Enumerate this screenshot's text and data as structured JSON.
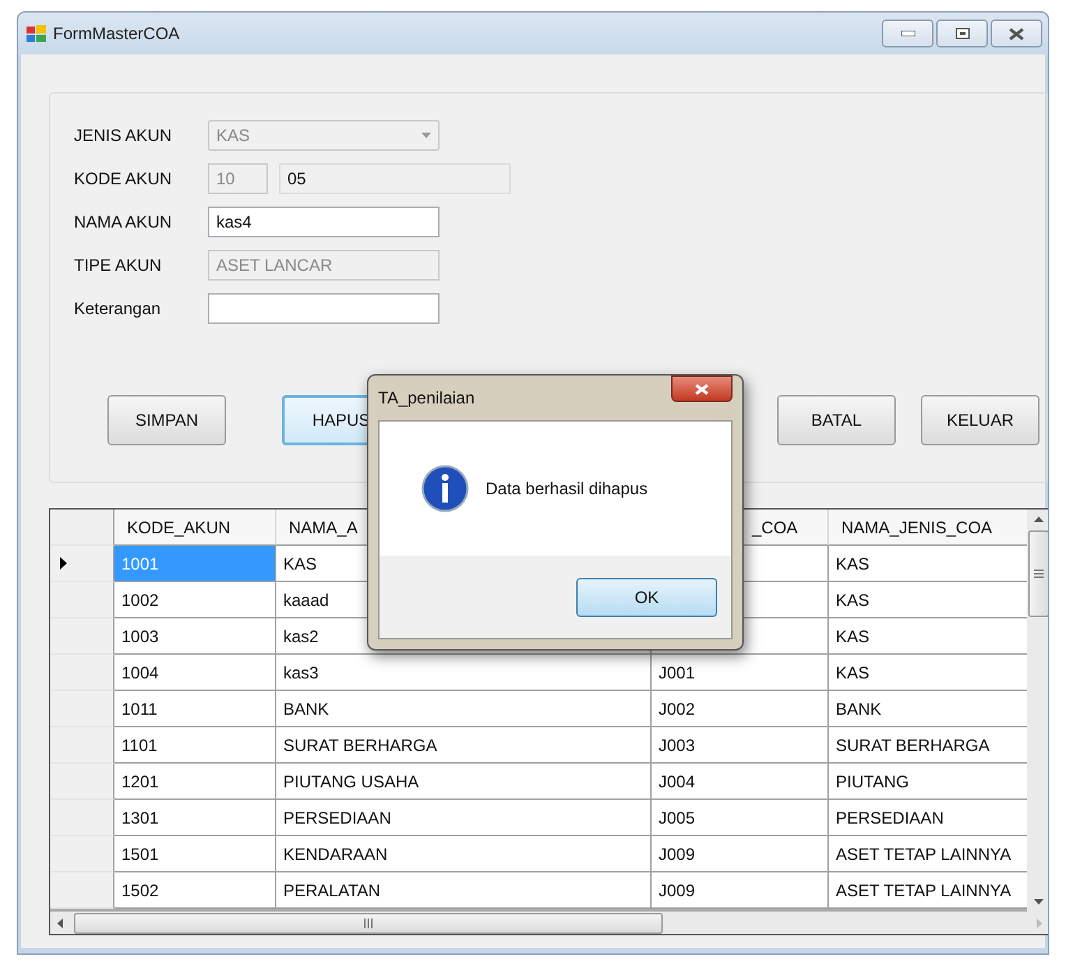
{
  "window": {
    "title": "FormMasterCOA"
  },
  "form": {
    "rows": [
      {
        "label": "JENIS AKUN",
        "fields": [
          {
            "kind": "combo",
            "value": "KAS",
            "disabled": true,
            "readonly": false
          }
        ]
      },
      {
        "label": "KODE AKUN",
        "fields": [
          {
            "kind": "short",
            "value": "10",
            "disabled": true,
            "readonly": false
          },
          {
            "kind": "text",
            "value": "05",
            "disabled": false,
            "readonly": true
          }
        ]
      },
      {
        "label": "NAMA AKUN",
        "fields": [
          {
            "kind": "text",
            "value": "kas4",
            "disabled": false,
            "readonly": false
          }
        ]
      },
      {
        "label": "TIPE AKUN",
        "fields": [
          {
            "kind": "text",
            "value": "ASET LANCAR",
            "disabled": true,
            "readonly": false
          }
        ]
      },
      {
        "label": "Keterangan",
        "fields": [
          {
            "kind": "text",
            "disabled": false,
            "readonly": false
          }
        ]
      }
    ]
  },
  "buttons": [
    {
      "label": "SIMPAN",
      "focused": false
    },
    {
      "label": "HAPUS",
      "focused": true
    },
    {
      "label": "BATAL",
      "focused": false
    },
    {
      "label": "KELUAR",
      "focused": false
    }
  ],
  "grid": {
    "columns": [
      "KODE_AKUN",
      "NAMA_A",
      "_COA",
      "NAMA_JENIS_COA"
    ],
    "rows": [
      {
        "selected": true,
        "cells": [
          "1001",
          "KAS",
          null,
          "KAS"
        ]
      },
      {
        "selected": false,
        "cells": [
          "1002",
          "kaaad",
          null,
          "KAS"
        ]
      },
      {
        "selected": false,
        "cells": [
          "1003",
          "kas2",
          null,
          "KAS"
        ]
      },
      {
        "selected": false,
        "cells": [
          "1004",
          "kas3",
          "J001",
          "KAS"
        ]
      },
      {
        "selected": false,
        "cells": [
          "1011",
          "BANK",
          "J002",
          "BANK"
        ]
      },
      {
        "selected": false,
        "cells": [
          "1101",
          "SURAT BERHARGA",
          "J003",
          "SURAT BERHARGA"
        ]
      },
      {
        "selected": false,
        "cells": [
          "1201",
          "PIUTANG USAHA",
          "J004",
          "PIUTANG"
        ]
      },
      {
        "selected": false,
        "cells": [
          "1301",
          "PERSEDIAAN",
          "J005",
          "PERSEDIAAN"
        ]
      },
      {
        "selected": false,
        "cells": [
          "1501",
          "KENDARAAN",
          "J009",
          "ASET TETAP LAINNYA"
        ]
      },
      {
        "selected": false,
        "cells": [
          "1502",
          "PERALATAN",
          "J009",
          "ASET TETAP LAINNYA"
        ]
      }
    ]
  },
  "dialog": {
    "title": "TA_penilaian",
    "message": "Data berhasil dihapus",
    "button": "OK"
  }
}
